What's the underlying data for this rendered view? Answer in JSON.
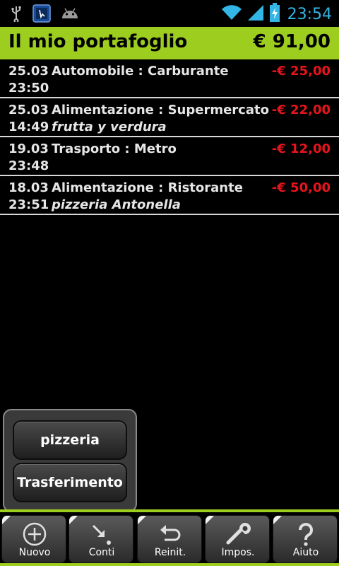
{
  "status_bar": {
    "time": "23:54",
    "icons": [
      "usb-icon",
      "notification-app-icon",
      "android-icon",
      "wifi-icon",
      "signal-icon",
      "battery-charging-icon"
    ]
  },
  "header": {
    "title": "Il mio portafoglio",
    "total": "€ 91,00",
    "color": "#9ccd1f"
  },
  "transactions": [
    {
      "date": "25.03",
      "time": "23:50",
      "category": "Automobile : Carburante",
      "note": "",
      "amount": "-€ 25,00"
    },
    {
      "date": "25.03",
      "time": "14:49",
      "category": "Alimentazione : Supermercato",
      "note": "frutta y verdura",
      "amount": "-€ 22,00"
    },
    {
      "date": "19.03",
      "time": "23:48",
      "category": "Trasporto : Metro",
      "note": "",
      "amount": "-€ 12,00"
    },
    {
      "date": "18.03",
      "time": "23:51",
      "category": "Alimentazione : Ristorante",
      "note": "pizzeria Antonella",
      "amount": "-€ 50,00"
    }
  ],
  "popup": {
    "options": [
      "pizzeria",
      "Trasferimento"
    ]
  },
  "toolbar": {
    "buttons": [
      {
        "label": "Nuovo",
        "icon": "plus-circle-icon"
      },
      {
        "label": "Conti",
        "icon": "accounts-arrow-icon"
      },
      {
        "label": "Reinit.",
        "icon": "undo-icon"
      },
      {
        "label": "Impos.",
        "icon": "wrench-icon"
      },
      {
        "label": "Aiuto",
        "icon": "question-icon"
      }
    ]
  },
  "colors": {
    "accent": "#9ccd1f",
    "negative_amount": "#e8141b",
    "clock": "#33b5e5"
  }
}
